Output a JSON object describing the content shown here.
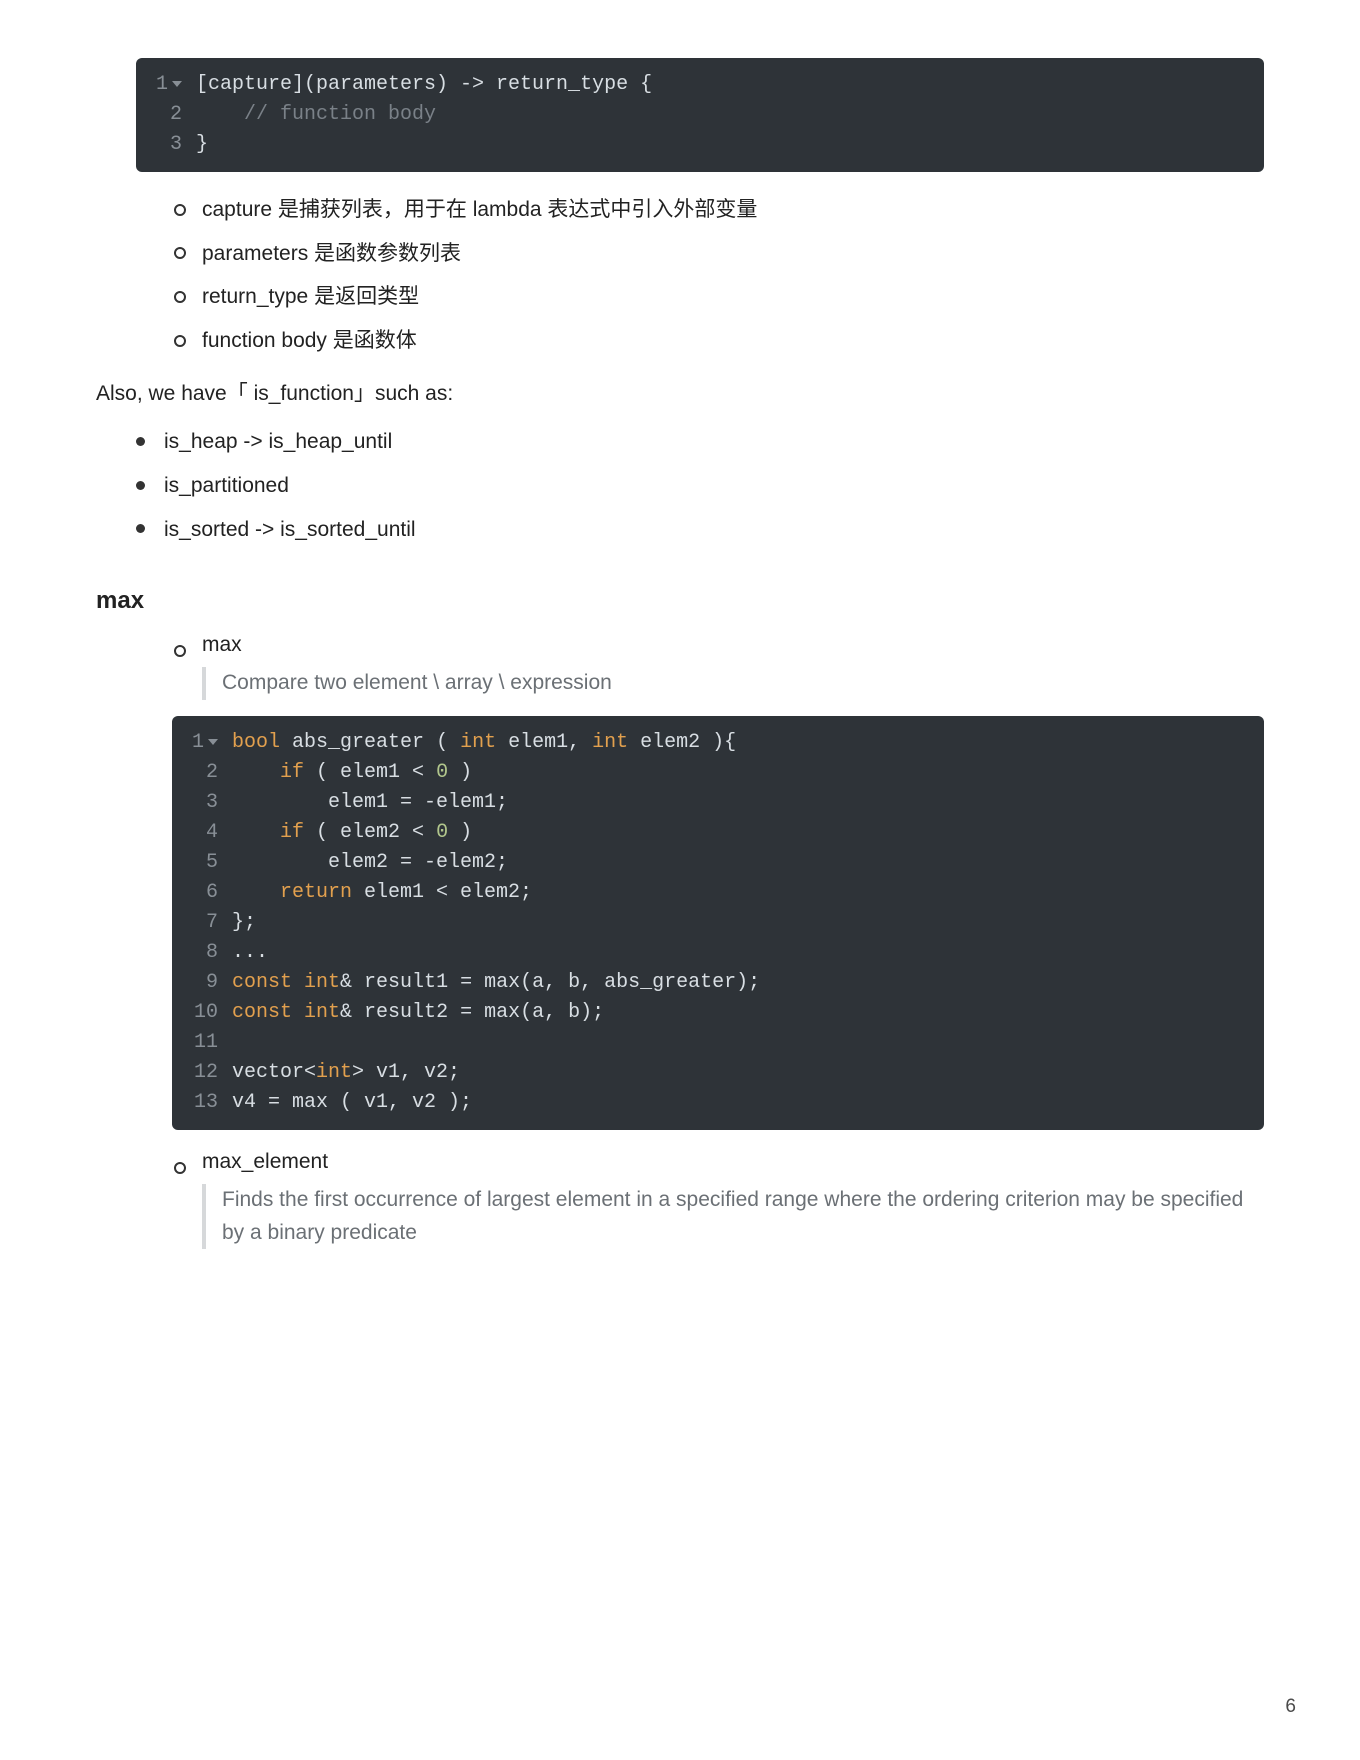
{
  "code_block_1": {
    "lines": [
      {
        "n": "1",
        "fold": true,
        "tokens": [
          {
            "t": "[capture](parameters) -> return_type {",
            "cls": "c-text"
          }
        ]
      },
      {
        "n": "2",
        "fold": false,
        "tokens": [
          {
            "t": "    ",
            "cls": "c-text"
          },
          {
            "t": "// function body",
            "cls": "c-comment"
          }
        ]
      },
      {
        "n": "3",
        "fold": false,
        "tokens": [
          {
            "t": "}",
            "cls": "c-text"
          }
        ]
      }
    ]
  },
  "lambda_notes": [
    "capture 是捕获列表，用于在 lambda 表达式中引入外部变量",
    "parameters 是函数参数列表",
    "return_type 是返回类型",
    "function body 是函数体"
  ],
  "also_line": "Also, we have「 is_function」such as:",
  "is_function_items": [
    "is_heap -> is_heap_until",
    "is_partitioned",
    "is_sorted -> is_sorted_until"
  ],
  "section_max_heading": "max",
  "max_item_label": "max",
  "max_quote": "Compare two element \\ array \\ expression",
  "code_block_2": {
    "lines": [
      {
        "n": "1",
        "fold": true,
        "tokens": [
          {
            "t": "bool",
            "cls": "c-kw"
          },
          {
            "t": " ",
            "cls": "c-text"
          },
          {
            "t": "abs_greater",
            "cls": "c-fn"
          },
          {
            "t": " ( ",
            "cls": "c-text"
          },
          {
            "t": "int",
            "cls": "c-type"
          },
          {
            "t": " elem1, ",
            "cls": "c-text"
          },
          {
            "t": "int",
            "cls": "c-type"
          },
          {
            "t": " elem2 ){",
            "cls": "c-text"
          }
        ]
      },
      {
        "n": "2",
        "fold": false,
        "tokens": [
          {
            "t": "    ",
            "cls": "c-text"
          },
          {
            "t": "if",
            "cls": "c-kw"
          },
          {
            "t": " ( elem1 < ",
            "cls": "c-text"
          },
          {
            "t": "0",
            "cls": "c-num"
          },
          {
            "t": " )",
            "cls": "c-text"
          }
        ]
      },
      {
        "n": "3",
        "fold": false,
        "tokens": [
          {
            "t": "        elem1 = -elem1;",
            "cls": "c-text"
          }
        ]
      },
      {
        "n": "4",
        "fold": false,
        "tokens": [
          {
            "t": "    ",
            "cls": "c-text"
          },
          {
            "t": "if",
            "cls": "c-kw"
          },
          {
            "t": " ( elem2 < ",
            "cls": "c-text"
          },
          {
            "t": "0",
            "cls": "c-num"
          },
          {
            "t": " )",
            "cls": "c-text"
          }
        ]
      },
      {
        "n": "5",
        "fold": false,
        "tokens": [
          {
            "t": "        elem2 = -elem2;",
            "cls": "c-text"
          }
        ]
      },
      {
        "n": "6",
        "fold": false,
        "tokens": [
          {
            "t": "    ",
            "cls": "c-text"
          },
          {
            "t": "return",
            "cls": "c-kw"
          },
          {
            "t": " elem1 < elem2;",
            "cls": "c-text"
          }
        ]
      },
      {
        "n": "7",
        "fold": false,
        "tokens": [
          {
            "t": "};",
            "cls": "c-text"
          }
        ]
      },
      {
        "n": "8",
        "fold": false,
        "tokens": [
          {
            "t": "...",
            "cls": "c-text"
          }
        ]
      },
      {
        "n": "9",
        "fold": false,
        "tokens": [
          {
            "t": "const",
            "cls": "c-kw"
          },
          {
            "t": " ",
            "cls": "c-text"
          },
          {
            "t": "int",
            "cls": "c-type"
          },
          {
            "t": "& result1 = max(a, b, abs_greater);",
            "cls": "c-text"
          }
        ]
      },
      {
        "n": "10",
        "fold": false,
        "tokens": [
          {
            "t": "const",
            "cls": "c-kw"
          },
          {
            "t": " ",
            "cls": "c-text"
          },
          {
            "t": "int",
            "cls": "c-type"
          },
          {
            "t": "& result2 = max(a, b);",
            "cls": "c-text"
          }
        ]
      },
      {
        "n": "11",
        "fold": false,
        "tokens": [
          {
            "t": "",
            "cls": "c-text"
          }
        ]
      },
      {
        "n": "12",
        "fold": false,
        "tokens": [
          {
            "t": "vector<",
            "cls": "c-text"
          },
          {
            "t": "int",
            "cls": "c-type"
          },
          {
            "t": "> v1, v2;",
            "cls": "c-text"
          }
        ]
      },
      {
        "n": "13",
        "fold": false,
        "tokens": [
          {
            "t": "v4 = max ( v1, v2 );",
            "cls": "c-text"
          }
        ]
      }
    ]
  },
  "max_element_label": "max_element",
  "max_element_quote": "Finds the first occurrence of largest element in a specified range where the ordering criterion may be specified by a binary predicate",
  "page_number": "6"
}
